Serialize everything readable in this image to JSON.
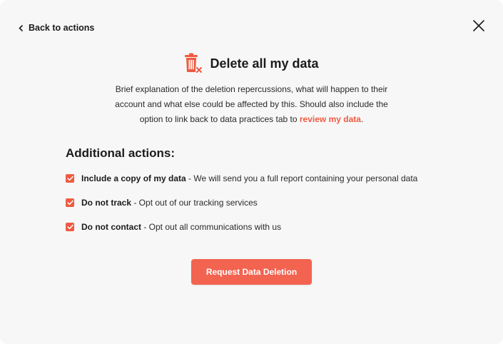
{
  "nav": {
    "back_label": "Back to actions",
    "back_icon": "chevron-left-icon",
    "close_icon": "close-icon"
  },
  "header": {
    "icon": "trash-delete-icon",
    "title": "Delete all my data"
  },
  "description": {
    "text": "Brief explanation of the deletion repercussions, what will happen to their account and what else could be affected by this. Should also include the option to link back to data practices tab to",
    "link_label": "review my data",
    "suffix": "."
  },
  "actions": {
    "heading": "Additional actions:",
    "items": [
      {
        "label": "Include a copy of my data",
        "detail": " - We will send you a full report containing your personal data",
        "checked": true
      },
      {
        "label": "Do not track",
        "detail": " - Opt out of our tracking services",
        "checked": true
      },
      {
        "label": "Do not contact",
        "detail": " - Opt out all communications with us",
        "checked": true
      }
    ]
  },
  "cta": {
    "label": "Request Data Deletion"
  },
  "colors": {
    "accent": "#ef5b42",
    "button": "#f26350",
    "panel": "#f7f7f7",
    "text": "#1b1b1b"
  }
}
